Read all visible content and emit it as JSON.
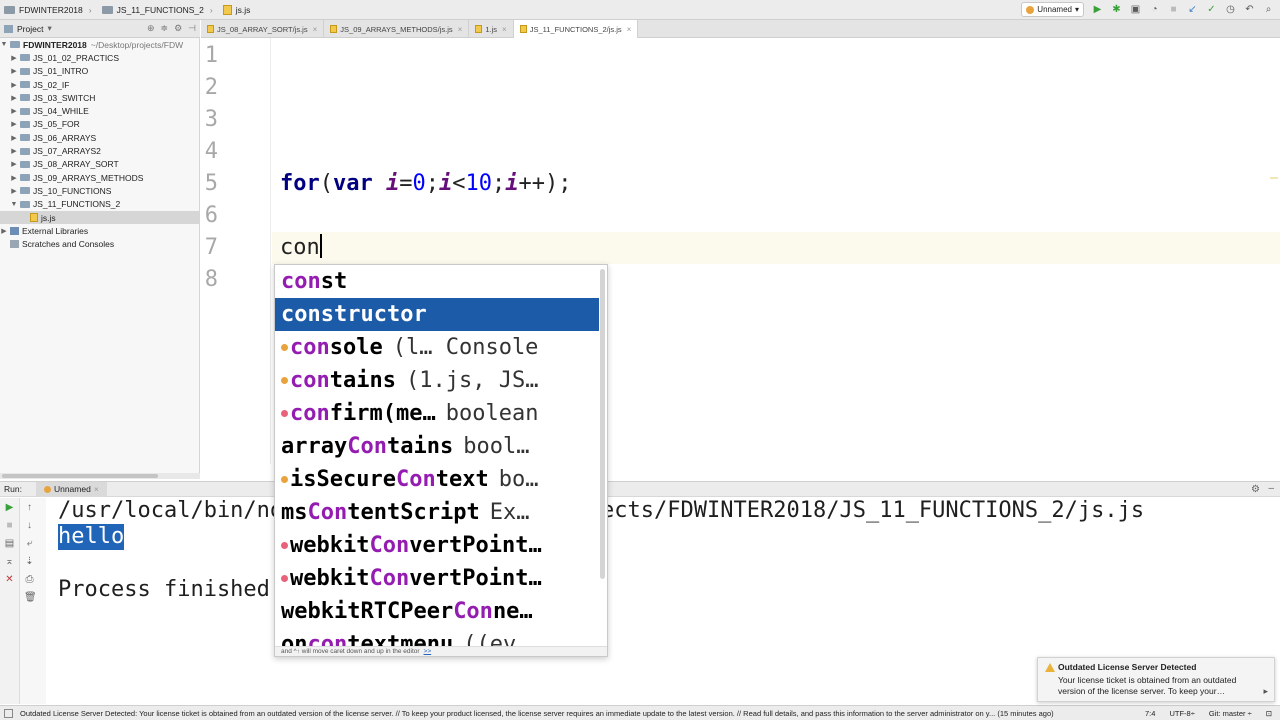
{
  "breadcrumb": [
    "FDWINTER2018",
    "JS_11_FUNCTIONS_2",
    "js.js"
  ],
  "toolbar": {
    "run_config": "Unnamed",
    "run_icon": "run-icon",
    "debug_icon": "debug-icon"
  },
  "project": {
    "header": "Project",
    "root": {
      "label": "FDWINTER2018",
      "path": "~/Desktop/projects/FDW"
    },
    "items": [
      "JS_01_02_PRACTICS",
      "JS_01_INTRO",
      "JS_02_IF",
      "JS_03_SWITCH",
      "JS_04_WHILE",
      "JS_05_FOR",
      "JS_06_ARRAYS",
      "JS_07_ARRAYS2",
      "JS_08_ARRAY_SORT",
      "JS_09_ARRAYS_METHODS",
      "JS_10_FUNCTIONS",
      "JS_11_FUNCTIONS_2"
    ],
    "open_file": "js.js",
    "external": "External Libraries",
    "scratches": "Scratches and Consoles"
  },
  "tabs": [
    {
      "label": "JS_08_ARRAY_SORT/js.js",
      "active": false
    },
    {
      "label": "JS_09_ARRAYS_METHODS/js.js",
      "active": false
    },
    {
      "label": "1.js",
      "active": false
    },
    {
      "label": "JS_11_FUNCTIONS_2/js.js",
      "active": true
    }
  ],
  "editor": {
    "line_numbers": [
      "1",
      "2",
      "3",
      "4",
      "5",
      "6",
      "7",
      "8"
    ],
    "line5": {
      "for": "for",
      "open": "(",
      "var": "var",
      "i1": "i",
      "eq": "=",
      "zero": "0",
      "semi1": ";",
      "i2": "i",
      "lt": "<",
      "ten": "10",
      "semi2": ";",
      "i3": "i",
      "inc": "++",
      "close": ");"
    },
    "line7": "con"
  },
  "completion": {
    "items": [
      {
        "match": "con",
        "rest": "st",
        "tail": "",
        "marker": "",
        "selected": false
      },
      {
        "match": "con",
        "rest": "structor",
        "tail": "",
        "marker": "",
        "selected": true
      },
      {
        "match": "con",
        "rest": "sole",
        "tail": "(l… Console",
        "marker": "v",
        "selected": false
      },
      {
        "match": "con",
        "rest": "tains",
        "tail": "(1.js, JS…",
        "marker": "v",
        "selected": false
      },
      {
        "match": "con",
        "rest": "firm(me…",
        "tail": "boolean",
        "marker": "a",
        "selected": false
      },
      {
        "pre": "array",
        "match": "Con",
        "rest": "tains",
        "tail": "bool…",
        "marker": "",
        "selected": false
      },
      {
        "pre": "isSecure",
        "match": "Con",
        "rest": "text",
        "tail": "bo…",
        "marker": "v",
        "selected": false
      },
      {
        "pre": "ms",
        "match": "Con",
        "rest": "tentScript",
        "tail": "Ex…",
        "marker": "",
        "selected": false
      },
      {
        "pre": "webkit",
        "match": "Con",
        "rest": "vertPoint…",
        "tail": "",
        "marker": "a",
        "selected": false
      },
      {
        "pre": "webkit",
        "match": "Con",
        "rest": "vertPoint…",
        "tail": "",
        "marker": "a",
        "selected": false
      },
      {
        "pre": "webkitRTCPeer",
        "match": "Con",
        "rest": "ne…",
        "tail": "",
        "marker": "",
        "selected": false
      },
      {
        "pre": "on",
        "match": "con",
        "rest": "textmenu",
        "tail": "((ev…",
        "marker": "",
        "selected": false
      }
    ],
    "hint": "and ^↑ will move caret down and up in the editor",
    "hint_link": ">>"
  },
  "run": {
    "header": "Run:",
    "tab": "Unnamed",
    "lines": [
      "/usr/local/bin/node /Users/…/Desktop/projects/FDWINTER2018/JS_11_FUNCTIONS_2/js.js",
      "hello",
      "",
      "Process finished with exit code 0"
    ]
  },
  "notification": {
    "title": "Outdated License Server Detected",
    "body": "Your license ticket is obtained from an outdated version of the license server. To keep your…"
  },
  "statusbar": {
    "message": "Outdated License Server Detected: Your license ticket is obtained from an outdated version of the license server. // To keep your product licensed, the license server requires an immediate update to the latest version. // Read full details, and pass this information to the server administrator on y... (15 minutes ago)",
    "position": "7:4",
    "encoding": "UTF-8÷",
    "git": "Git: master ÷"
  },
  "colors": {
    "keyword": "#000080",
    "variable": "#660e7a",
    "number": "#0000ff",
    "selection": "#1c5ba8",
    "match": "#951cb0"
  }
}
